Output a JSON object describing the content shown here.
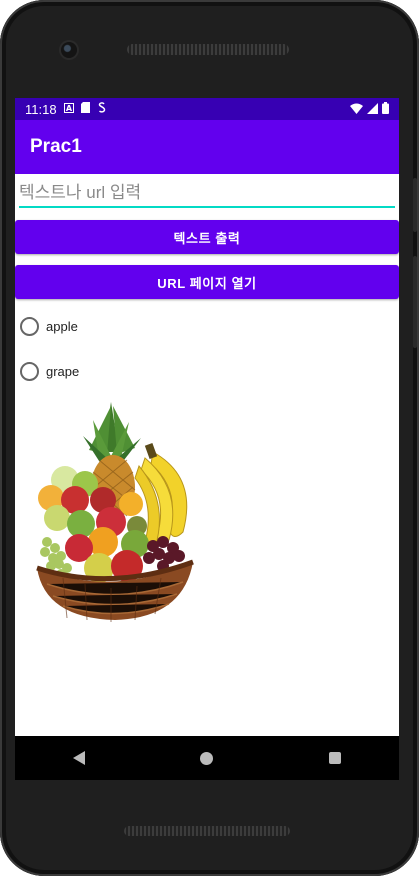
{
  "status_bar": {
    "time": "11:18",
    "left_icons": [
      "A",
      "▮",
      "S"
    ],
    "right_icons": [
      "wifi-icon",
      "signal-icon",
      "battery-icon"
    ]
  },
  "app_bar": {
    "title": "Prac1",
    "color": "#6200ee",
    "status_color": "#3700b3"
  },
  "input": {
    "placeholder": "텍스트나 url 입력",
    "value": "",
    "underline_color": "#03dac5"
  },
  "buttons": {
    "text_output": "텍스트 출력",
    "open_url": "URL 페이지 열기"
  },
  "radios": [
    {
      "label": "apple",
      "checked": false
    },
    {
      "label": "grape",
      "checked": false
    }
  ],
  "image": {
    "icon": "fruit-basket-image"
  },
  "nav": {
    "back": "back-icon",
    "home": "home-icon",
    "recents": "recents-icon"
  }
}
